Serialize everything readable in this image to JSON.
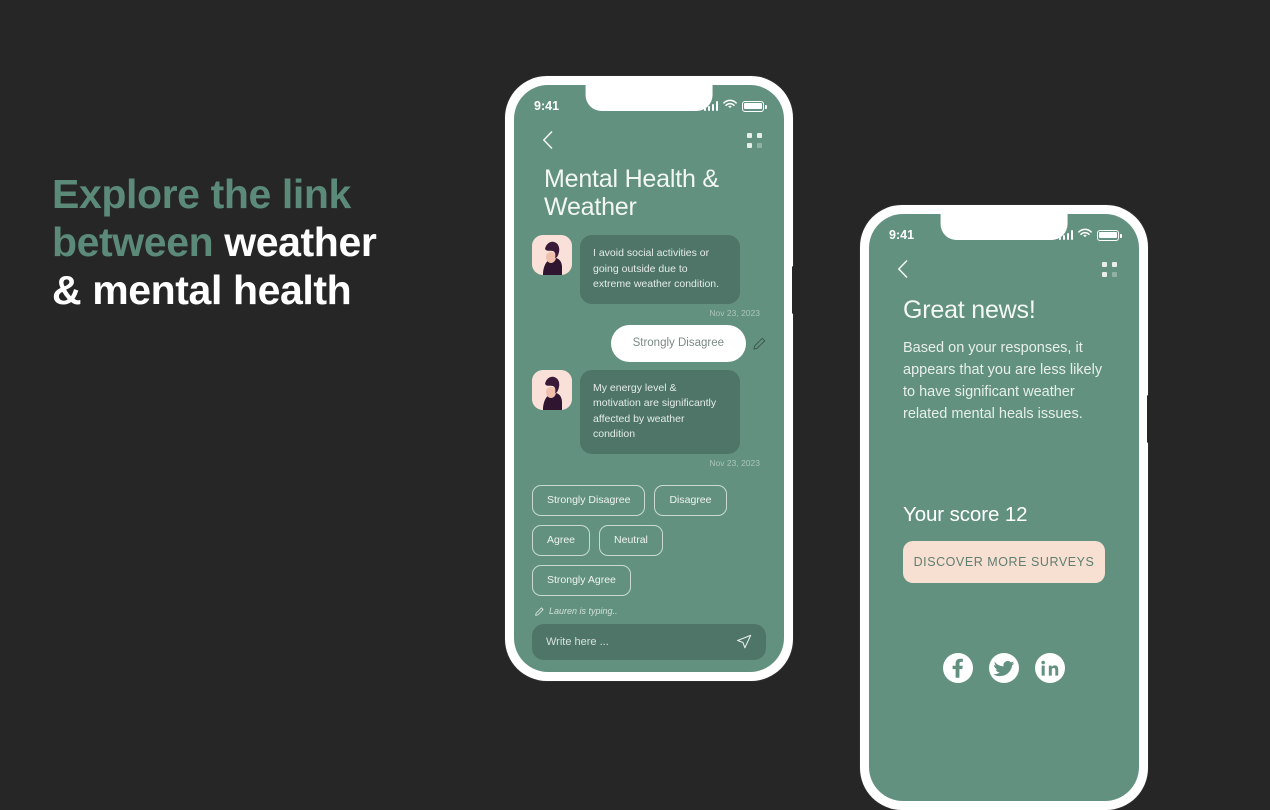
{
  "headline": {
    "line1_accent": "Explore the link",
    "line2_accent": "between",
    "line2_white": "weather",
    "line3_white": "& mental health",
    "accent_color": "#5b8a78",
    "white_color": "#ffffff"
  },
  "theme": {
    "page_background": "#262626",
    "screen_green": "#63917f",
    "bubble_green": "#4e7567",
    "peach": "#f7dfd2",
    "white": "#ffffff"
  },
  "phone_one": {
    "status": {
      "time": "9:41",
      "signal_icon": "signal-bars-icon",
      "wifi_icon": "wifi-icon",
      "battery_icon": "battery-icon"
    },
    "nav": {
      "back_icon": "chevron-left-icon",
      "menu_icon": "grid-dots-icon"
    },
    "title": "Mental Health & Weather",
    "messages": [
      {
        "type": "incoming",
        "avatar": "user-avatar",
        "text": "I avoid social activities or going outside due to extreme weather condition.",
        "timestamp": "Nov 23, 2023"
      },
      {
        "type": "outgoing",
        "text": "Strongly Disagree",
        "edit_icon": "pencil-edit-icon"
      },
      {
        "type": "incoming",
        "avatar": "user-avatar",
        "text": "My energy level & motivation are significantly affected by weather condition",
        "timestamp": "Nov 23, 2023"
      }
    ],
    "options": [
      "Strongly Disagree",
      "Disagree",
      "Agree",
      "Neutral",
      "Strongly Agree"
    ],
    "composer": {
      "typing_icon": "pencil-icon",
      "typing_status": "Lauren is typing..",
      "input_placeholder": "Write here ...",
      "input_value": "",
      "send_icon": "send-paper-plane-icon"
    }
  },
  "phone_two": {
    "status": {
      "time": "9:41",
      "signal_icon": "signal-bars-icon",
      "wifi_icon": "wifi-icon",
      "battery_icon": "battery-icon"
    },
    "nav": {
      "back_icon": "chevron-left-icon",
      "menu_icon": "grid-dots-icon"
    },
    "title": "Great news!",
    "description": "Based on your responses, it appears that you are  less likely to have significant weather related mental heals issues.",
    "score_label": "Your score 12",
    "cta_label": "DISCOVER MORE SURVEYS",
    "socials": [
      {
        "name": "facebook-icon",
        "label": "Facebook"
      },
      {
        "name": "twitter-icon",
        "label": "Twitter"
      },
      {
        "name": "linkedin-icon",
        "label": "LinkedIn"
      }
    ]
  }
}
